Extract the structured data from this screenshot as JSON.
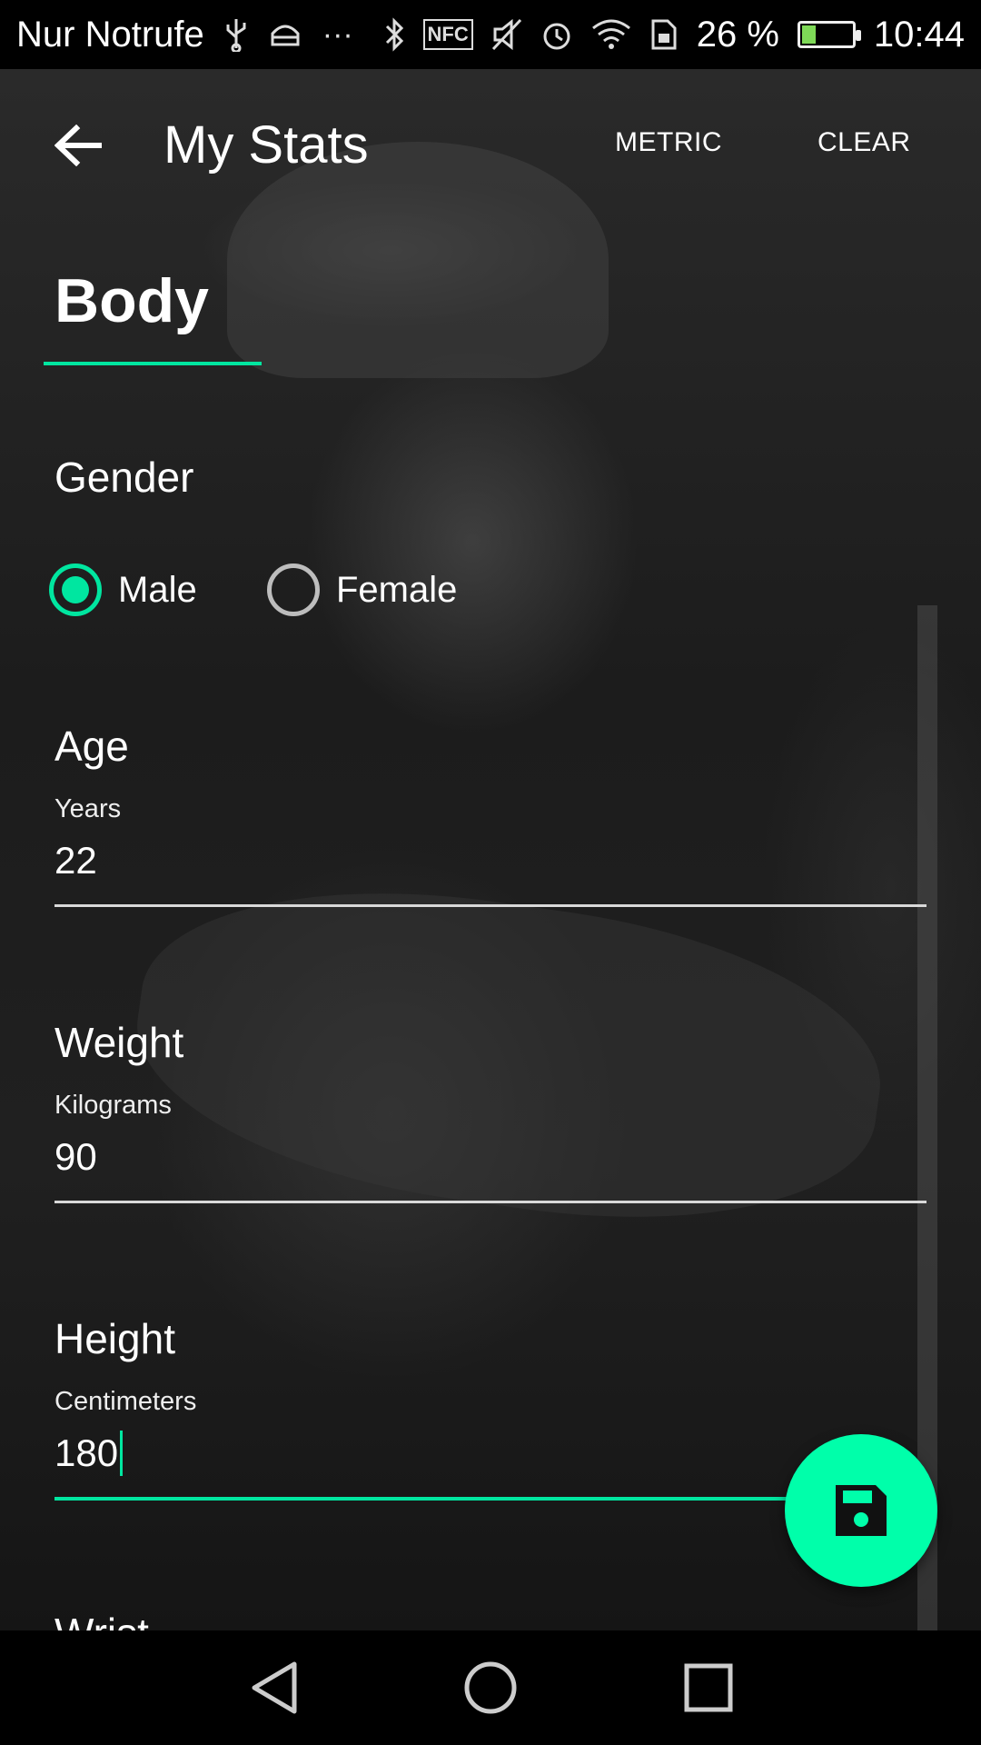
{
  "status_bar": {
    "carrier": "Nur Notrufe",
    "extra_dots": "···",
    "nfc": "NFC",
    "battery_percent": "26 %",
    "battery_level": 0.26,
    "time": "10:44"
  },
  "app_bar": {
    "title": "My Stats",
    "metric_label": "METRIC",
    "clear_label": "CLEAR"
  },
  "tabs": [
    {
      "label": "Body",
      "selected": true
    }
  ],
  "gender": {
    "label": "Gender",
    "options": [
      {
        "label": "Male",
        "selected": true
      },
      {
        "label": "Female",
        "selected": false
      }
    ]
  },
  "age": {
    "label": "Age",
    "hint": "Years",
    "value": "22"
  },
  "weight": {
    "label": "Weight",
    "hint": "Kilograms",
    "value": "90"
  },
  "height": {
    "label": "Height",
    "hint": "Centimeters",
    "value": "180"
  },
  "wrist": {
    "label": "Wrist"
  },
  "colors": {
    "accent": "#00e6a0",
    "fab": "#00ffaa"
  }
}
